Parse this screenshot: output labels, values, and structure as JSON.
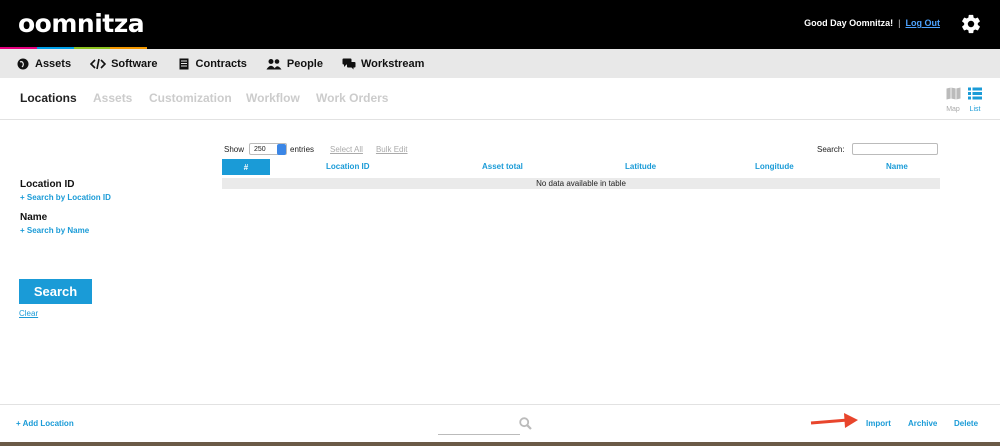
{
  "header": {
    "logo": "oomnitza",
    "logo_colors": [
      "#e6007e",
      "#00a0e9",
      "#8dc21f",
      "#f39800"
    ],
    "greeting": "Good Day Oomnitza!",
    "separator": "|",
    "logout": "Log Out"
  },
  "nav": {
    "items": [
      {
        "label": "Assets",
        "icon": "globe-icon"
      },
      {
        "label": "Software",
        "icon": "code-icon"
      },
      {
        "label": "Contracts",
        "icon": "document-icon"
      },
      {
        "label": "People",
        "icon": "people-icon"
      },
      {
        "label": "Workstream",
        "icon": "chat-icon"
      }
    ]
  },
  "subnav": {
    "tabs": [
      "Locations",
      "Assets",
      "Customization",
      "Workflow",
      "Work Orders"
    ],
    "active_tab": "Locations",
    "views": {
      "map": "Map",
      "list": "List",
      "active": "List"
    }
  },
  "sidebar": {
    "location_id_label": "Location ID",
    "location_id_link": "+ Search by Location ID",
    "name_label": "Name",
    "name_link": "+ Search by Name",
    "search_button": "Search",
    "clear_link": "Clear"
  },
  "table": {
    "show_label": "Show",
    "entries_value": "250",
    "entries_label": "entries",
    "select_all": "Select All",
    "bulk_edit": "Bulk Edit",
    "search_label": "Search:",
    "columns": [
      "#",
      "Location ID",
      "Asset total",
      "Latitude",
      "Longitude",
      "Name"
    ],
    "empty_message": "No data available in table"
  },
  "footer": {
    "add_location": "+ Add Location",
    "actions": [
      "Import",
      "Archive",
      "Delete"
    ]
  },
  "colors": {
    "accent": "#1a9bd7",
    "topbar": "#000000",
    "navbar": "#e8e8e8",
    "annotation_arrow": "#e8452c"
  }
}
